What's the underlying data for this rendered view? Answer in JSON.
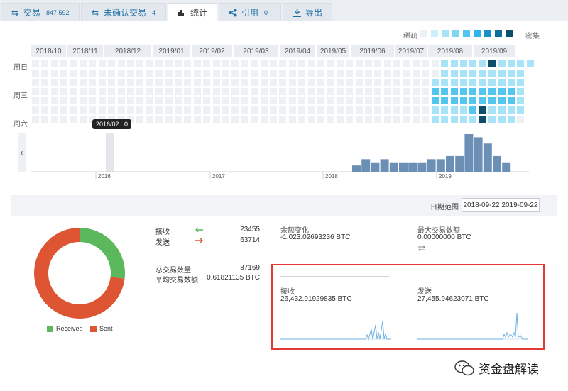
{
  "tabs": [
    {
      "label": "交易",
      "count": "847,592",
      "icon": "swap-icon"
    },
    {
      "label": "未确认交易",
      "count": "4",
      "icon": "swap-icon"
    },
    {
      "label": "统计",
      "count": "",
      "icon": "bar-chart-icon"
    },
    {
      "label": "引用",
      "count": "0",
      "icon": "share-icon"
    },
    {
      "label": "导出",
      "count": "",
      "icon": "download-icon"
    }
  ],
  "heatmap": {
    "legend_sparse": "稀疏",
    "legend_dense": "密集",
    "legend_colors": [
      "#eef1f4",
      "#cdeffb",
      "#a8e3f8",
      "#7fd5f3",
      "#52c6ee",
      "#2fb6e8",
      "#1a8fc4",
      "#0f6e96",
      "#0b4f6c"
    ],
    "months": [
      "2018/10",
      "2018/11",
      "2018/12",
      "2019/01",
      "2019/02",
      "2019/03",
      "2019/04",
      "2019/05",
      "2019/06",
      "2019/07",
      "2019/08",
      "2019/09"
    ],
    "day_labels": [
      "周日",
      "周三",
      "周六"
    ],
    "colors": {
      "empty": "#eef1f4",
      "light": "#a8e3f8",
      "mid": "#52c6ee",
      "dark": "#0b4f6c"
    }
  },
  "timeline": {
    "tooltip": "2016/02 : 0",
    "years": [
      "2016",
      "2017",
      "2018",
      "2019"
    ],
    "bar_values": [
      2,
      4,
      3,
      4,
      3,
      3,
      3,
      3,
      4,
      4,
      5,
      5,
      12,
      11,
      9,
      5,
      3
    ],
    "bar_color": "#6c8fb5"
  },
  "range": {
    "label": "日期范围",
    "value": "2018-09-22  2019-09-22"
  },
  "donut": {
    "received_label": "Received",
    "sent_label": "Sent",
    "received_value": 23455,
    "sent_value": 63714,
    "received_color": "#5cb85c",
    "sent_color": "#dd5533"
  },
  "stats": {
    "receive_label": "接收",
    "receive_count": "23455",
    "send_label": "发送",
    "send_count": "63714",
    "total_label": "总交易数量",
    "total_value": "87169",
    "avg_label": "平均交易数额",
    "avg_value": "0.61821135 BTC",
    "balance_label": "余额变化",
    "balance_value": "-1,023.02693236 BTC",
    "max_label": "最大交易数额",
    "max_value": "0.00000000 BTC",
    "recv_total_label": "接收",
    "recv_total_value": "26,432.91929835 BTC",
    "sent_total_label": "发送",
    "sent_total_value": "27,455.94623071 BTC"
  },
  "watermark": {
    "text": "资金盘解读"
  }
}
